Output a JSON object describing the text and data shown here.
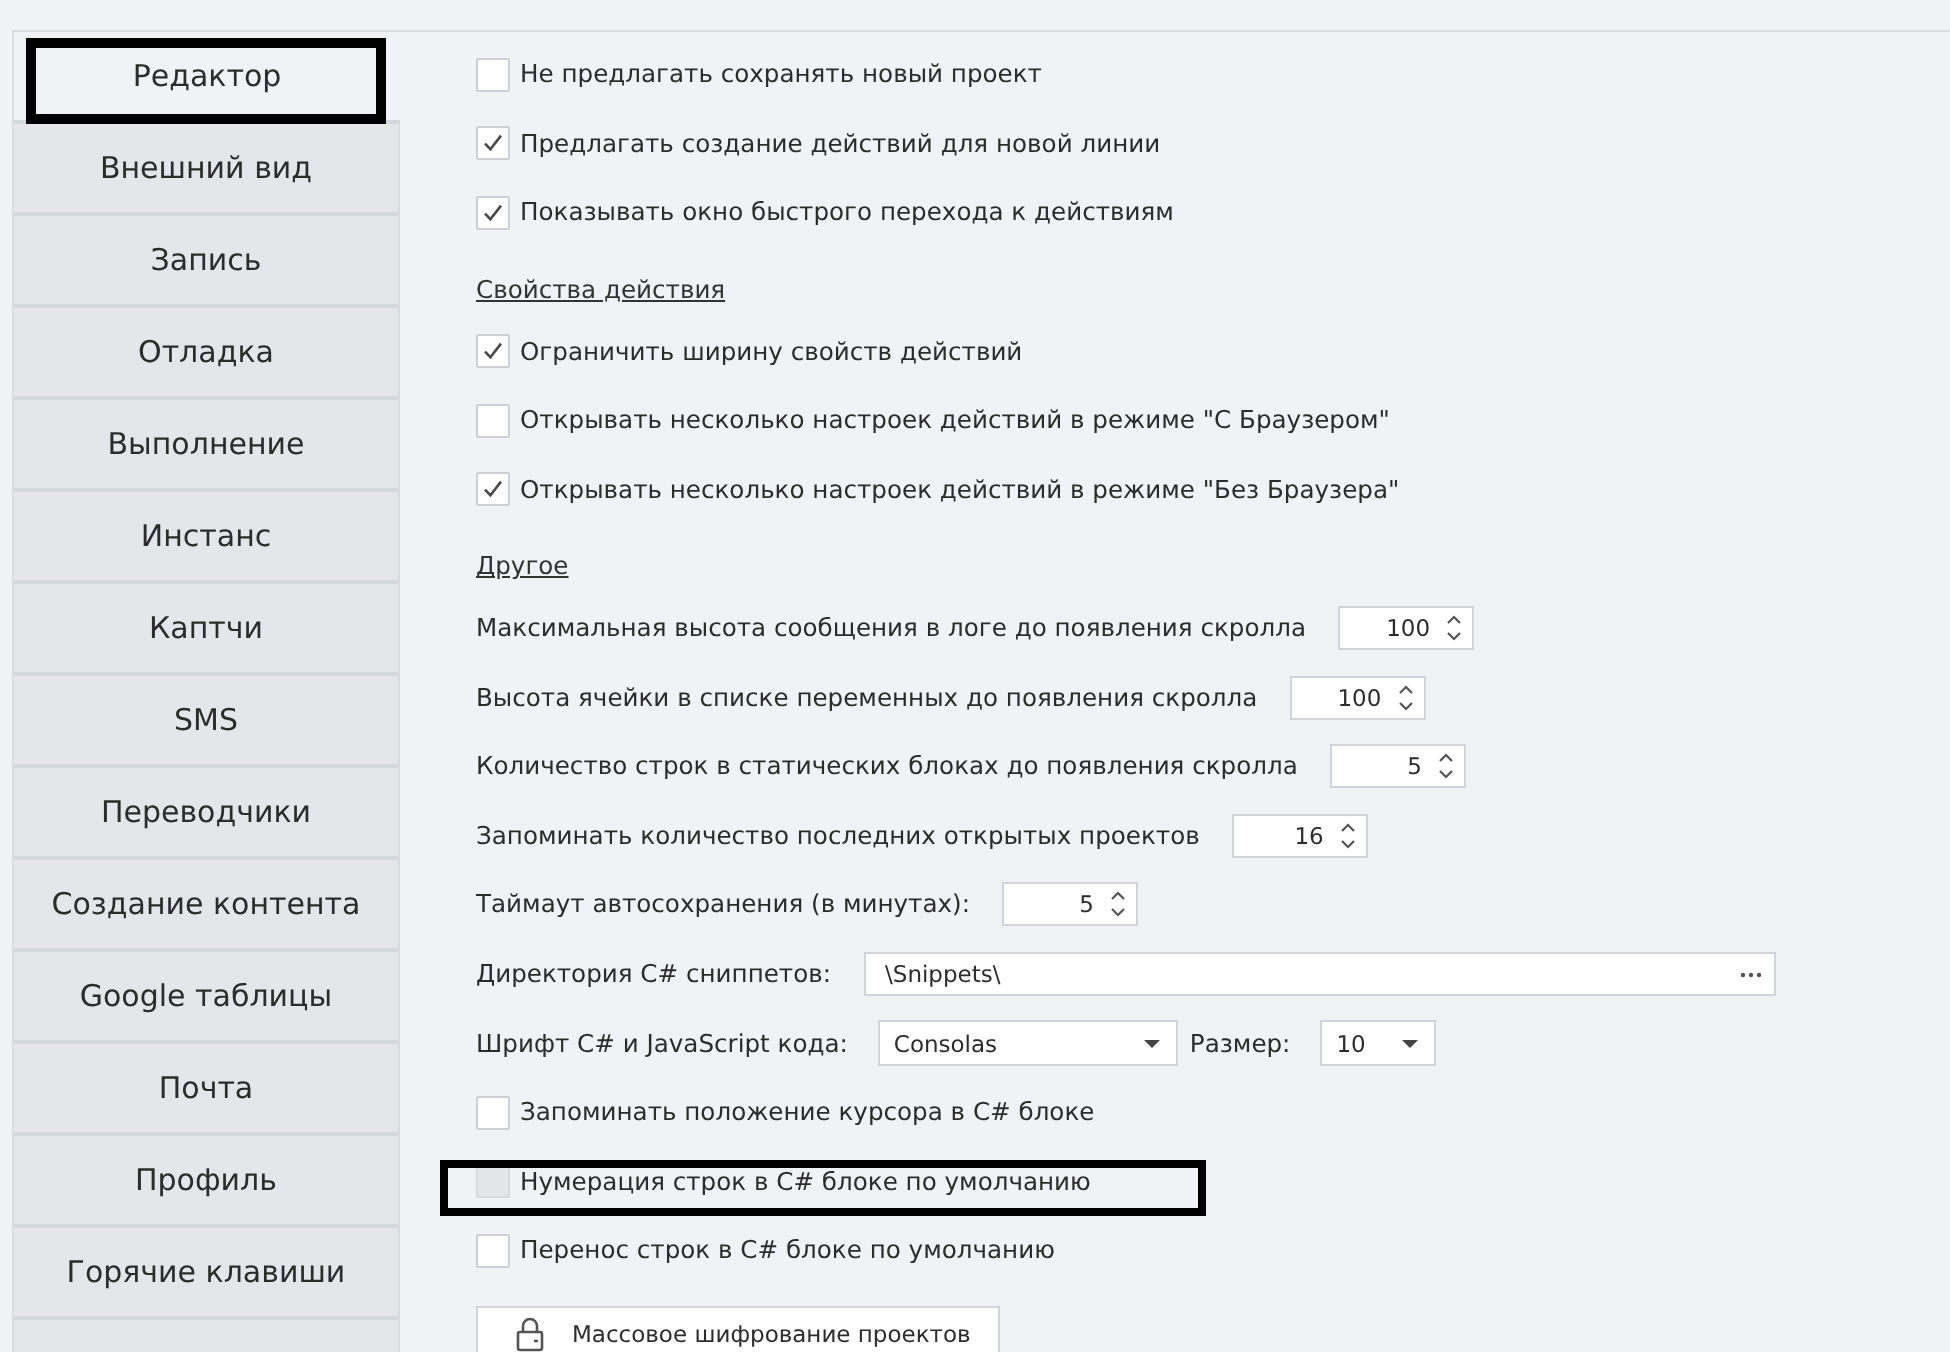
{
  "sidebar": {
    "tabs": [
      {
        "label": "Редактор",
        "selected": true,
        "highlighted": true
      },
      {
        "label": "Внешний вид",
        "selected": false,
        "highlighted": false
      },
      {
        "label": "Запись",
        "selected": false,
        "highlighted": false
      },
      {
        "label": "Отладка",
        "selected": false,
        "highlighted": false
      },
      {
        "label": "Выполнение",
        "selected": false,
        "highlighted": false
      },
      {
        "label": "Инстанс",
        "selected": false,
        "highlighted": false
      },
      {
        "label": "Каптчи",
        "selected": false,
        "highlighted": false
      },
      {
        "label": "SMS",
        "selected": false,
        "highlighted": false
      },
      {
        "label": "Переводчики",
        "selected": false,
        "highlighted": false
      },
      {
        "label": "Создание контента",
        "selected": false,
        "highlighted": false
      },
      {
        "label": "Google таблицы",
        "selected": false,
        "highlighted": false
      },
      {
        "label": "Почта",
        "selected": false,
        "highlighted": false
      },
      {
        "label": "Профиль",
        "selected": false,
        "highlighted": false
      },
      {
        "label": "Горячие клавиши",
        "selected": false,
        "highlighted": false
      }
    ]
  },
  "settings": [
    {
      "kind": "checkbox",
      "label": "Не предлагать сохранять новый проект",
      "checked": false,
      "disabled": false,
      "highlighted": false
    },
    {
      "kind": "checkbox",
      "label": "Предлагать создание действий для новой линии",
      "checked": true,
      "disabled": false,
      "highlighted": false
    },
    {
      "kind": "checkbox",
      "label": "Показывать окно быстрого перехода к действиям",
      "checked": true,
      "disabled": false,
      "highlighted": false
    },
    {
      "kind": "heading",
      "label": "Свойства действия"
    },
    {
      "kind": "checkbox",
      "label": "Ограничить ширину свойств действий",
      "checked": true,
      "disabled": false,
      "highlighted": false
    },
    {
      "kind": "checkbox",
      "label": "Открывать несколько настроек действий в режиме \"С Браузером\"",
      "checked": false,
      "disabled": false,
      "highlighted": false
    },
    {
      "kind": "checkbox",
      "label": "Открывать несколько настроек действий в режиме \"Без Браузера\"",
      "checked": true,
      "disabled": false,
      "highlighted": false
    },
    {
      "kind": "heading",
      "label": "Другое"
    },
    {
      "kind": "spinner",
      "label": "Максимальная высота сообщения в логе до появления скролла",
      "value": "100"
    },
    {
      "kind": "spinner",
      "label": "Высота ячейки в списке переменных до появления скролла",
      "value": "100"
    },
    {
      "kind": "spinner",
      "label": "Количество строк в статических блоках до появления скролла",
      "value": "5"
    },
    {
      "kind": "spinner",
      "label": "Запоминать количество последних открытых проектов",
      "value": "16"
    },
    {
      "kind": "spinner",
      "label": "Таймаут автосохранения (в минутах):",
      "value": "5"
    },
    {
      "kind": "path",
      "label": "Директория C# сниппетов:",
      "value": "\\Snippets\\"
    },
    {
      "kind": "font",
      "label": "Шрифт C# и JavaScript кода:",
      "font": "Consolas",
      "size_label": "Размер:",
      "size": "10"
    },
    {
      "kind": "checkbox",
      "label": "Запоминать положение курсора в C# блоке",
      "checked": false,
      "disabled": false,
      "highlighted": false
    },
    {
      "kind": "checkbox",
      "label": "Нумерация строк в C# блоке по умолчанию",
      "checked": false,
      "disabled": true,
      "highlighted": true
    },
    {
      "kind": "checkbox",
      "label": "Перенос строк в C# блоке по умолчанию",
      "checked": false,
      "disabled": false,
      "highlighted": false
    },
    {
      "kind": "button",
      "label": "Массовое шифрование проектов"
    }
  ]
}
